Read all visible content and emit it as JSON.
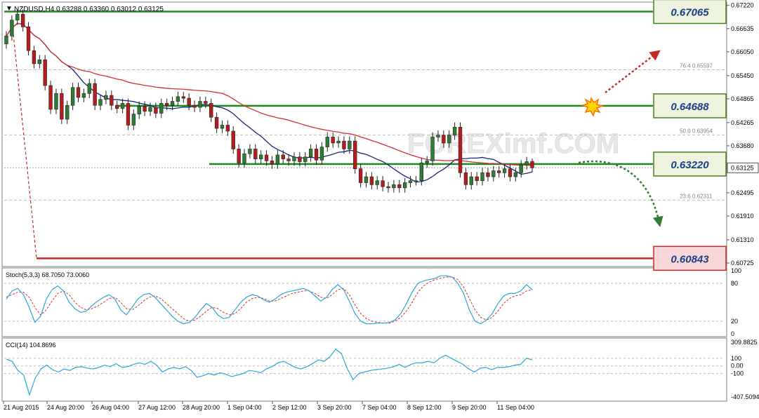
{
  "header": {
    "symbol_line": "NZDUSD,H4  0.63288 0.63360 0.63012 0.63125",
    "menu_glyph": "▼"
  },
  "watermark": "FOREXimf.COM",
  "colors": {
    "bull": "#2e7d32",
    "bear": "#b71c1c",
    "level_green": "#1f8a1f",
    "level_red": "#c62828",
    "ma_fast": "#1a237e",
    "ma_slow": "#d32f2f",
    "stoch_main": "#29a8d8",
    "stoch_signal": "#d32f2f",
    "cci": "#29a8d8",
    "fib_line": "#bdbdbd",
    "arrow_up": "#c62828",
    "arrow_down": "#2e7d32"
  },
  "price_axis": {
    "ticks": [
      "0.67220",
      "0.66635",
      "0.66050",
      "0.65450",
      "0.64865",
      "0.64265",
      "0.63680",
      "0.63125",
      "0.62495",
      "0.61910",
      "0.61310",
      "0.60725"
    ],
    "current_price": "0.63125"
  },
  "levels": [
    {
      "id": "l1",
      "label": "0.67065",
      "kind": "green"
    },
    {
      "id": "l2",
      "label": "0.64688",
      "kind": "green"
    },
    {
      "id": "l3",
      "label": "0.63220",
      "kind": "green"
    },
    {
      "id": "l4",
      "label": "0.60843",
      "kind": "red"
    }
  ],
  "fib": [
    {
      "label": "76.4",
      "value_text": "0.65597"
    },
    {
      "label": "50.0",
      "value_text": "0.63954"
    },
    {
      "label": "23.6",
      "value_text": "0.62311"
    }
  ],
  "stoch": {
    "title": "Stoch(5,3,3) 68.7050 73.0060",
    "ticks": [
      "100",
      "80",
      "20",
      "0"
    ],
    "main": [
      55,
      68,
      72,
      62,
      42,
      18,
      28,
      55,
      70,
      76,
      68,
      50,
      40,
      34,
      36,
      45,
      52,
      58,
      62,
      55,
      38,
      30,
      42,
      55,
      62,
      64,
      58,
      48,
      38,
      28,
      20,
      16,
      18,
      26,
      38,
      48,
      42,
      30,
      24,
      26,
      38,
      50,
      58,
      62,
      60,
      54,
      50,
      55,
      62,
      66,
      68,
      70,
      72,
      68,
      60,
      52,
      58,
      70,
      78,
      70,
      52,
      32,
      20,
      16,
      16,
      17,
      17,
      18,
      22,
      32,
      48,
      66,
      80,
      84,
      86,
      88,
      92,
      92,
      90,
      80,
      64,
      38,
      20,
      16,
      22,
      32,
      48,
      60,
      64,
      64,
      68,
      78,
      70
    ],
    "signal": [
      58,
      62,
      66,
      66,
      58,
      42,
      30,
      38,
      52,
      64,
      68,
      62,
      50,
      42,
      38,
      40,
      44,
      50,
      56,
      58,
      50,
      40,
      38,
      44,
      52,
      58,
      60,
      56,
      48,
      40,
      32,
      24,
      20,
      22,
      28,
      36,
      42,
      40,
      34,
      30,
      32,
      40,
      50,
      56,
      58,
      56,
      52,
      52,
      56,
      60,
      64,
      66,
      68,
      68,
      64,
      58,
      56,
      62,
      70,
      72,
      62,
      46,
      32,
      24,
      20,
      18,
      17,
      17,
      20,
      26,
      36,
      50,
      66,
      76,
      82,
      86,
      88,
      90,
      90,
      86,
      74,
      56,
      38,
      26,
      22,
      26,
      36,
      48,
      56,
      60,
      62,
      68,
      70
    ]
  },
  "cci": {
    "title": "CCI(14) 104.8696",
    "ticks": [
      "309.8825",
      "100",
      "0.00",
      "-100",
      "-407.5094"
    ],
    "values": [
      90,
      60,
      -60,
      -120,
      -380,
      -160,
      -40,
      10,
      -50,
      -80,
      -40,
      -60,
      -20,
      -10,
      -30,
      -40,
      -20,
      10,
      -10,
      30,
      -20,
      -10,
      20,
      40,
      20,
      60,
      10,
      -80,
      -40,
      -20,
      -40,
      -10,
      -60,
      -150,
      -130,
      -100,
      -120,
      -90,
      -110,
      -140,
      -120,
      -100,
      -60,
      -70,
      -90,
      -40,
      -10,
      40,
      60,
      20,
      -20,
      -40,
      -10,
      30,
      80,
      60,
      120,
      220,
      160,
      -40,
      -180,
      -100,
      -80,
      -60,
      -50,
      -40,
      -30,
      -10,
      20,
      -20,
      20,
      40,
      40,
      60,
      40,
      100,
      140,
      100,
      60,
      20,
      -40,
      -80,
      -30,
      -20,
      -50,
      -20,
      -20,
      -10,
      10,
      20,
      100,
      80
    ]
  },
  "time_axis": {
    "labels": [
      "21 Aug 2015",
      "24 Aug 20:00",
      "26 Aug 04:00",
      "27 Aug 12:00",
      "28 Aug 20:00",
      "1 Sep 04:00",
      "2 Sep 12:00",
      "3 Sep 20:00",
      "7 Sep 04:00",
      "8 Sep 12:00",
      "9 Sep 20:00",
      "11 Sep 04:00"
    ]
  },
  "chart_data": {
    "type": "candlestick",
    "symbol": "NZDUSD",
    "timeframe": "H4",
    "last_bar": {
      "open": 0.63288,
      "high": 0.6336,
      "low": 0.63012,
      "close": 0.63125
    },
    "ylim": [
      0.6069,
      0.6725
    ],
    "x_labels": [
      "21 Aug 2015",
      "24 Aug 20:00",
      "26 Aug 04:00",
      "27 Aug 12:00",
      "28 Aug 20:00",
      "1 Sep 04:00",
      "2 Sep 12:00",
      "3 Sep 20:00",
      "7 Sep 04:00",
      "8 Sep 12:00",
      "9 Sep 20:00",
      "11 Sep 04:00"
    ],
    "closes": [
      0.6645,
      0.6685,
      0.67,
      0.6668,
      0.6608,
      0.6575,
      0.6585,
      0.652,
      0.646,
      0.65,
      0.6435,
      0.647,
      0.6515,
      0.649,
      0.65,
      0.6525,
      0.647,
      0.6485,
      0.6495,
      0.647,
      0.6462,
      0.6475,
      0.642,
      0.6448,
      0.6468,
      0.6455,
      0.6465,
      0.645,
      0.6475,
      0.647,
      0.648,
      0.6492,
      0.6488,
      0.647,
      0.6465,
      0.648,
      0.6475,
      0.644,
      0.6412,
      0.642,
      0.6405,
      0.636,
      0.6325,
      0.6348,
      0.636,
      0.6335,
      0.6345,
      0.633,
      0.6322,
      0.6345,
      0.6335,
      0.633,
      0.634,
      0.6328,
      0.634,
      0.636,
      0.6332,
      0.6365,
      0.639,
      0.6375,
      0.638,
      0.636,
      0.638,
      0.631,
      0.6275,
      0.629,
      0.627,
      0.628,
      0.6265,
      0.6262,
      0.627,
      0.6262,
      0.6275,
      0.628,
      0.628,
      0.6325,
      0.633,
      0.639,
      0.6395,
      0.6375,
      0.6395,
      0.6415,
      0.63,
      0.627,
      0.629,
      0.628,
      0.63,
      0.629,
      0.6305,
      0.63,
      0.631,
      0.629,
      0.63,
      0.632,
      0.6328,
      0.63125
    ],
    "moving_averages": [
      {
        "name": "fast",
        "color": "#1a237e"
      },
      {
        "name": "slow",
        "color": "#d32f2f"
      }
    ],
    "horizontal_levels": [
      0.67065,
      0.64688,
      0.6322,
      0.60843
    ],
    "fibonacci": [
      {
        "ratio": "76.4",
        "price": 0.65597
      },
      {
        "ratio": "50.0",
        "price": 0.63954
      },
      {
        "ratio": "23.6",
        "price": 0.62311
      }
    ],
    "current_price": 0.63125,
    "indicators": [
      {
        "name": "Stoch(5,3,3)",
        "values": [
          68.705,
          73.006
        ],
        "levels": [
          20,
          80
        ]
      },
      {
        "name": "CCI(14)",
        "value": 104.8696,
        "levels": [
          -100,
          0,
          100
        ]
      }
    ]
  }
}
